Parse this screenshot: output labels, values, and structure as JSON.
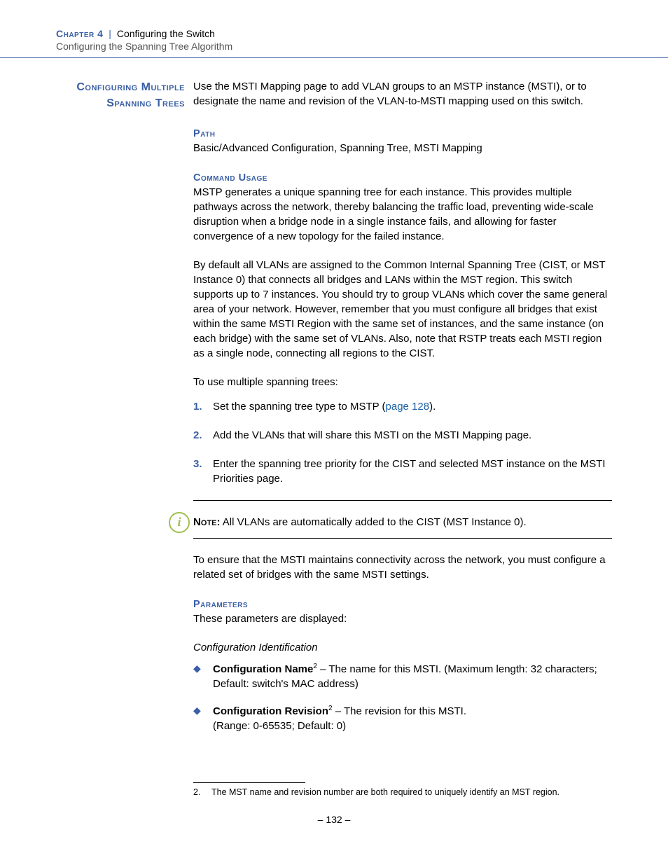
{
  "header": {
    "chapter": "Chapter 4",
    "divider": "|",
    "section": "Configuring the Switch",
    "subsection": "Configuring the Spanning Tree Algorithm"
  },
  "side_heading": "Configuring Multiple Spanning Trees",
  "intro": "Use the MSTI Mapping page to add VLAN groups to an MSTP instance (MSTI), or to designate the name and revision of the VLAN-to-MSTI mapping used on this switch.",
  "path": {
    "label": "Path",
    "text": "Basic/Advanced Configuration, Spanning Tree, MSTI Mapping"
  },
  "command_usage": {
    "label": "Command Usage",
    "p1": "MSTP generates a unique spanning tree for each instance. This provides multiple pathways across the network, thereby balancing the traffic load, preventing wide-scale disruption when a bridge node in a single instance fails, and allowing for faster convergence of a new topology for the failed instance.",
    "p2": "By default all VLANs are assigned to the Common Internal Spanning Tree (CIST, or MST Instance 0) that connects all bridges and LANs within the MST region. This switch supports up to 7 instances. You should try to group VLANs which cover the same general area of your network. However, remember that you must configure all bridges that exist within the same MSTI Region with the same set of instances, and the same instance (on each bridge) with the same set of VLANs. Also, note that RSTP treats each MSTI region as a single node, connecting all regions to the CIST.",
    "p3": "To use multiple spanning trees:"
  },
  "steps": [
    {
      "num": "1.",
      "pre": "Set the spanning tree type to MSTP (",
      "link": "page 128",
      "post": ")."
    },
    {
      "num": "2.",
      "text": "Add the VLANs that will share this MSTI on the MSTI Mapping page."
    },
    {
      "num": "3.",
      "text": "Enter the spanning tree priority for the CIST and selected MST instance on the MSTI Priorities page."
    }
  ],
  "note": {
    "label": "Note:",
    "text": " All VLANs are automatically added to the CIST (MST Instance 0)."
  },
  "after_note": "To ensure that the MSTI maintains connectivity across the network, you must configure a related set of bridges with the same MSTI settings.",
  "parameters": {
    "label": "Parameters",
    "intro": "These parameters are displayed:",
    "group_title": "Configuration Identification",
    "items": [
      {
        "name": "Configuration Name",
        "sup": "2",
        "desc": " – The name for this MSTI. (Maximum length: 32 characters; Default: switch's MAC address)"
      },
      {
        "name": "Configuration Revision",
        "sup": "2",
        "desc_line1": " – The revision for this MSTI.",
        "desc_line2": "(Range: 0-65535; Default: 0)"
      }
    ]
  },
  "footnote": {
    "num": "2.",
    "text": "The MST name and revision number are both required to uniquely identify an MST region."
  },
  "page_number": "–  132  –"
}
